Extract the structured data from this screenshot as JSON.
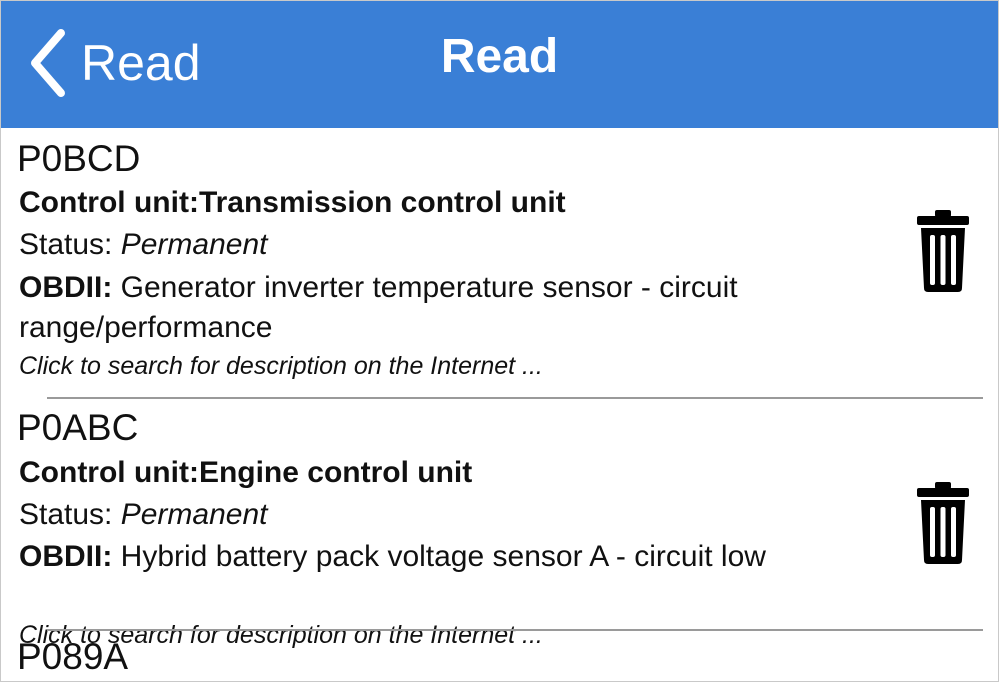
{
  "header": {
    "back_label": "Read",
    "title": "Read",
    "background_color": "#3a7fd6"
  },
  "dtc_list": [
    {
      "code": "P0BCD",
      "control_unit": "Control unit:Transmission control unit",
      "status_label": "Status: ",
      "status_value": "Permanent",
      "obd_label": "OBDII:",
      "obd_text": " Generator inverter temperature sensor - circuit range/performance",
      "hint": "Click to search for description on the Internet ...",
      "delete_icon": "trash-icon"
    },
    {
      "code": "P0ABC",
      "control_unit": "Control unit:Engine control unit",
      "status_label": "Status: ",
      "status_value": "Permanent",
      "obd_label": "OBDII:",
      "obd_text": " Hybrid battery pack voltage sensor A - circuit low",
      "hint": "Click to search for description on the Internet ...",
      "delete_icon": "trash-icon"
    },
    {
      "code": "P089A"
    }
  ]
}
